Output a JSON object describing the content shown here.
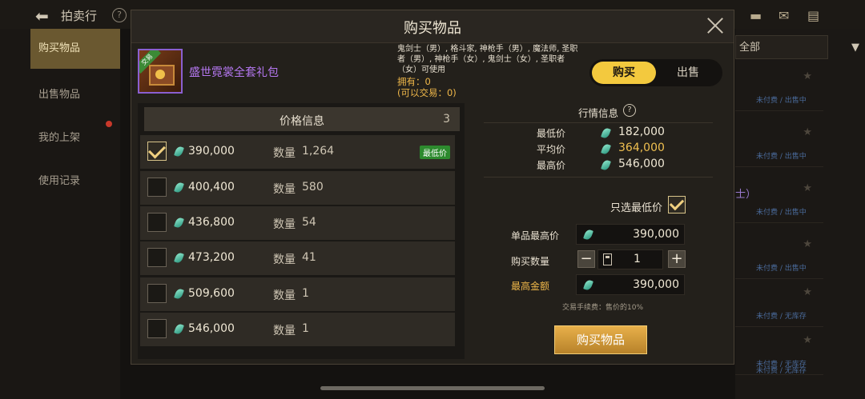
{
  "background": {
    "title": "拍卖行",
    "sidebar": [
      "购买物品",
      "出售物品",
      "我的上架",
      "使用记录"
    ],
    "dropdown_value": "全部",
    "row_statuses": [
      "未付费 / 出售中",
      "未付费 / 出售中",
      "未付费 / 出售中",
      "未付费 / 出售中",
      "未付费 / 无库存",
      "未付费 / 无库存",
      "未付费 / 无库存"
    ],
    "partial_text": "士）"
  },
  "modal": {
    "title": "购买物品",
    "item": {
      "tag": "交易",
      "name": "盛世霓裳全套礼包",
      "classes": "鬼剑士（男）, 格斗家, 神枪手（男）, 魔法师, 圣职者（男）, 神枪手（女）, 鬼剑士（女）, 圣职者（女）可使用",
      "owned": "拥有：0",
      "tradable": "(可以交易：0)"
    },
    "tabs": {
      "buy": "购买",
      "sell": "出售",
      "active": "buy"
    },
    "price_list": {
      "header": "价格信息",
      "count": "3",
      "qty_label": "数量",
      "lowest_badge": "最低价",
      "rows": [
        {
          "price": "390,000",
          "qty": "1,264",
          "checked": true,
          "lowest": true
        },
        {
          "price": "400,400",
          "qty": "580",
          "checked": false,
          "lowest": false
        },
        {
          "price": "436,800",
          "qty": "54",
          "checked": false,
          "lowest": false
        },
        {
          "price": "473,200",
          "qty": "41",
          "checked": false,
          "lowest": false
        },
        {
          "price": "509,600",
          "qty": "1",
          "checked": false,
          "lowest": false
        },
        {
          "price": "546,000",
          "qty": "1",
          "checked": false,
          "lowest": false
        }
      ]
    },
    "market": {
      "title": "行情信息",
      "min_label": "最低价",
      "min_value": "182,000",
      "avg_label": "平均价",
      "avg_value": "364,000",
      "max_label": "最高价",
      "max_value": "546,000"
    },
    "form": {
      "lowest_only_label": "只选最低价",
      "lowest_only_checked": true,
      "unit_max_label": "单品最高价",
      "unit_max_value": "390,000",
      "qty_label": "购买数量",
      "qty_value": "1",
      "total_max_label": "最高金额",
      "total_max_value": "390,000",
      "fee_note": "交易手续费：售价的10%",
      "buy_button": "购买物品"
    },
    "colors": {
      "accent_gold": "#f3c93e",
      "avg_price": "#f0c050",
      "item_name": "#b477f0",
      "lowest_badge": "#2d8a2e"
    }
  }
}
